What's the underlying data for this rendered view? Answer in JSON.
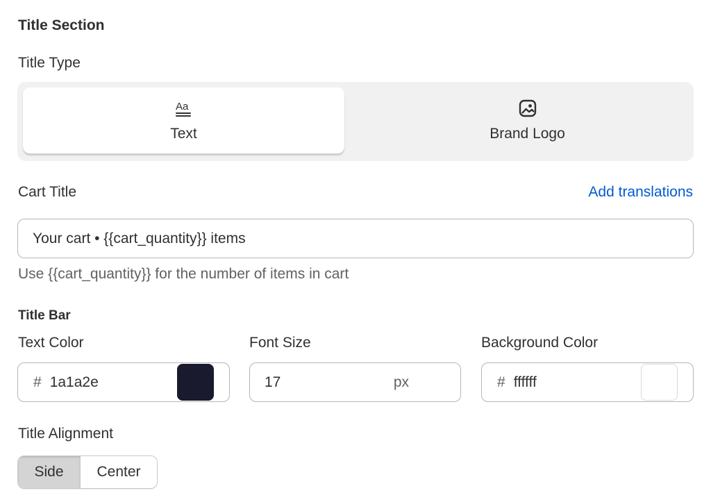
{
  "section_title": "Title Section",
  "title_type": {
    "label": "Title Type",
    "options": [
      {
        "label": "Text",
        "icon": "text-format-icon",
        "selected": true
      },
      {
        "label": "Brand Logo",
        "icon": "image-icon",
        "selected": false
      }
    ]
  },
  "cart_title": {
    "label": "Cart Title",
    "link": "Add translations",
    "value": "Your cart • {{cart_quantity}} items",
    "help": "Use {{cart_quantity}} for the number of items in cart"
  },
  "title_bar": {
    "heading": "Title Bar",
    "text_color": {
      "label": "Text Color",
      "prefix": "#",
      "value": "1a1a2e",
      "swatch": "#1a1a2e"
    },
    "font_size": {
      "label": "Font Size",
      "value": "17",
      "suffix": "px"
    },
    "background_color": {
      "label": "Background Color",
      "prefix": "#",
      "value": "ffffff",
      "swatch": "#ffffff"
    }
  },
  "title_alignment": {
    "label": "Title Alignment",
    "options": [
      "Side",
      "Center"
    ],
    "selected": "Side"
  },
  "colors": {
    "link": "#005bd3",
    "text": "#303030",
    "muted": "#616161"
  }
}
